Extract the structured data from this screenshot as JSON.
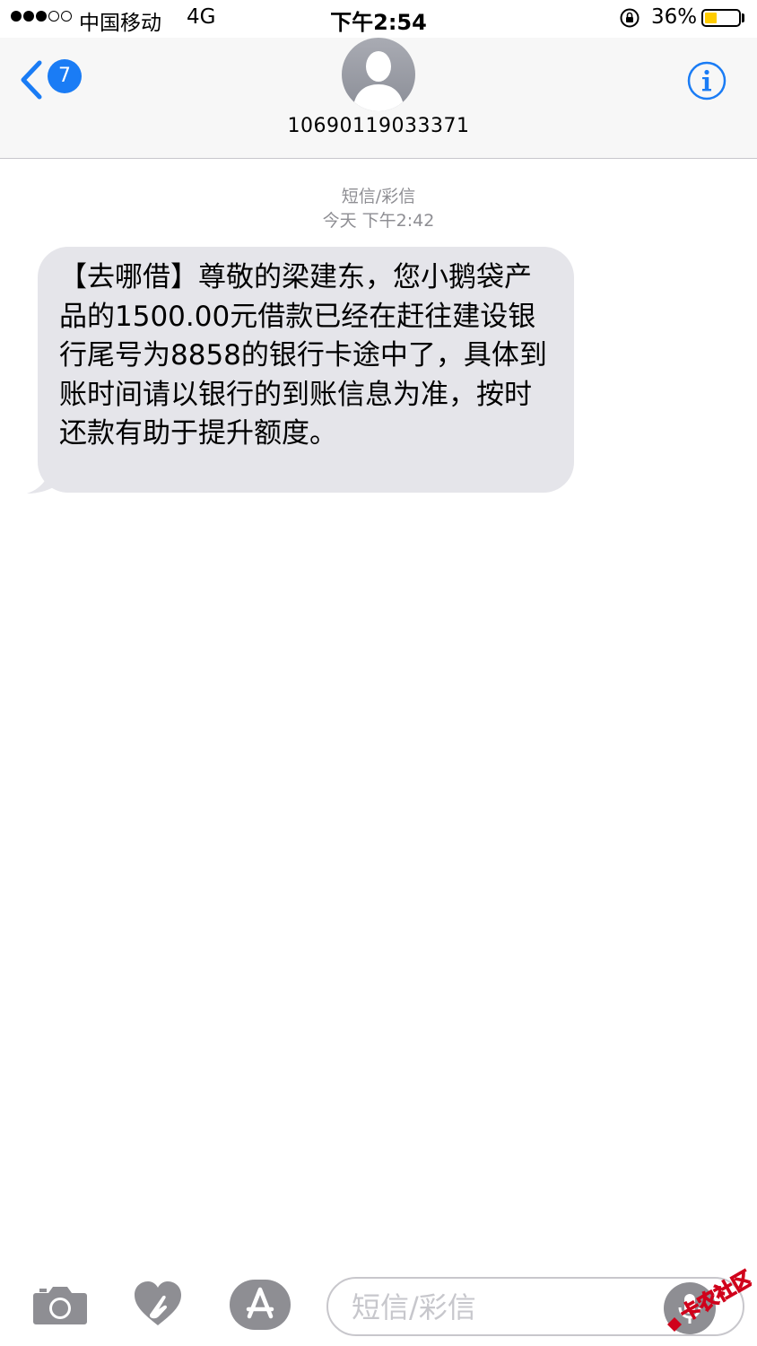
{
  "status_bar": {
    "carrier": "中国移动",
    "network": "4G",
    "time": "下午2:54",
    "battery_percent": "36%",
    "battery_level": 0.36,
    "signal_bars": 3,
    "signal_max": 5
  },
  "header": {
    "back_badge": "7",
    "contact": "10690119033371",
    "accent_color": "#1a7cf5"
  },
  "conversation": {
    "message_type": "短信/彩信",
    "timestamp": "今天 下午2:42",
    "messages": [
      {
        "direction": "incoming",
        "text": "【去哪借】尊敬的梁建东，您小鹅袋产品的1500.00元借款已经在赶往建设银行尾号为8858的银行卡途中了，具体到账时间请以银行的到账信息为准，按时还款有助于提升额度。"
      }
    ]
  },
  "composer": {
    "placeholder": "短信/彩信",
    "value": ""
  },
  "watermark": {
    "text": "卡农社区"
  },
  "icons": {
    "back": "chevron-left-icon",
    "info": "info-icon",
    "camera": "camera-icon",
    "digital_touch": "heart-hand-icon",
    "app_store": "app-store-icon",
    "mic": "microphone-icon",
    "lock": "orientation-lock-icon"
  }
}
